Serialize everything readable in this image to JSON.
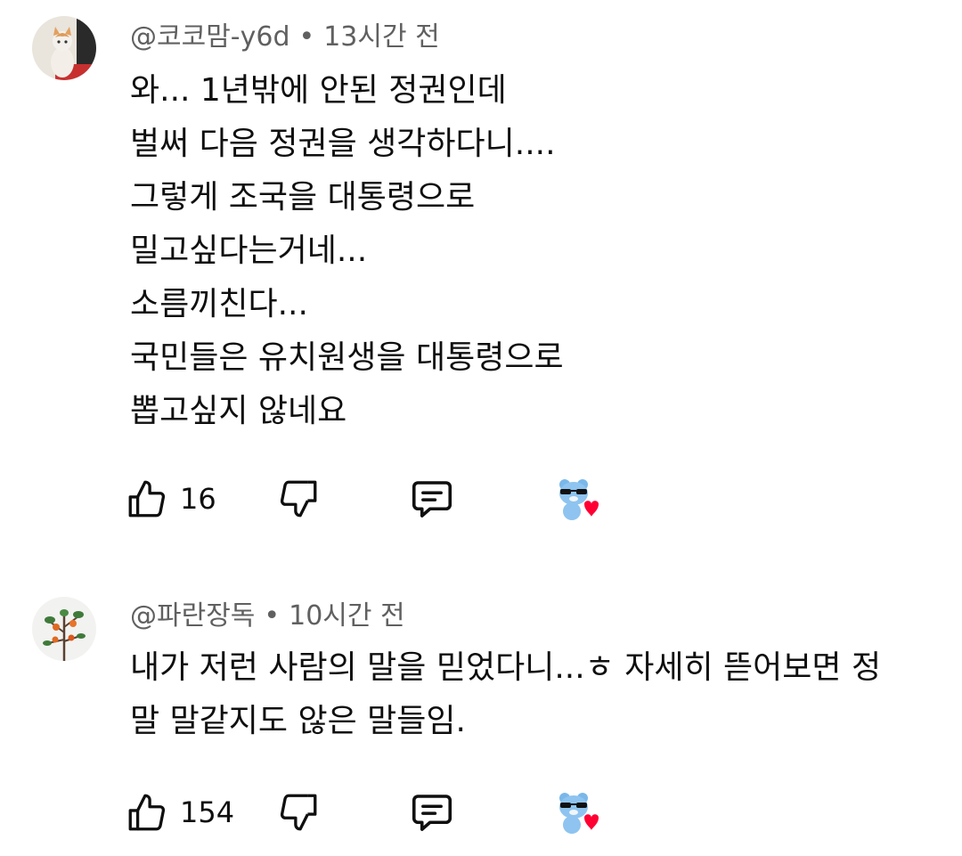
{
  "comments": [
    {
      "author": "@코코맘-y6d",
      "separator": "•",
      "time": "13시간 전",
      "avatar": "cat-photo",
      "lines": [
        "와... 1년밖에 안된 정권인데",
        "벌써 다음 정권을 생각하다니....",
        "그렇게 조국을 대통령으로",
        "밀고싶다는거네...",
        "소름끼친다...",
        "국민들은 유치원생을 대통령으로",
        "뽑고싶지 않네요"
      ],
      "likes": "16",
      "creator_heart": true
    },
    {
      "author": "@파란장독",
      "separator": "•",
      "time": "10시간 전",
      "avatar": "flower-plant-photo",
      "lines": [
        "내가 저런 사람의 말을 믿었다니...ㅎ  자세히 뜯어보면 정",
        "말 말같지도 않은 말들임."
      ],
      "likes": "154",
      "creator_heart": true
    }
  ],
  "icons": {
    "like": "thumbs-up-icon",
    "dislike": "thumbs-down-icon",
    "reply": "reply-icon",
    "heart": "creator-heart-icon"
  },
  "colors": {
    "text": "#0f0f0f",
    "meta": "#606060",
    "heart": "#ff0033",
    "mascot": "#7ab8ea"
  }
}
